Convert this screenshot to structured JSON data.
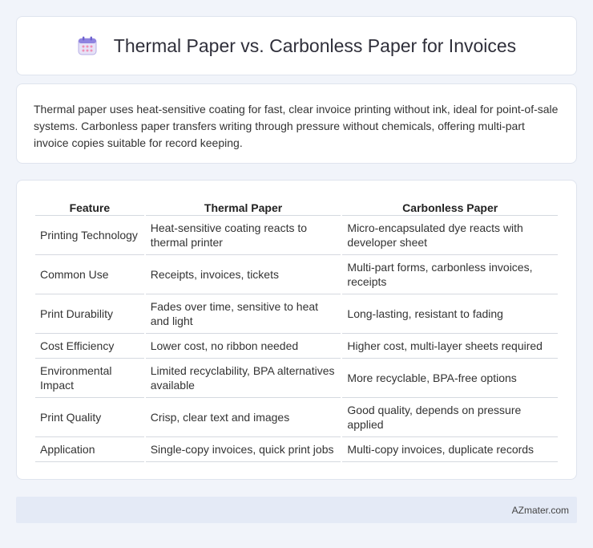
{
  "header": {
    "title": "Thermal Paper vs. Carbonless Paper for Invoices",
    "icon": "calendar-icon"
  },
  "intro": {
    "text": "Thermal paper uses heat-sensitive coating for fast, clear invoice printing without ink, ideal for point-of-sale systems. Carbonless paper transfers writing through pressure without chemicals, offering multi-part invoice copies suitable for record keeping."
  },
  "table": {
    "headers": [
      "Feature",
      "Thermal Paper",
      "Carbonless Paper"
    ],
    "rows": [
      [
        "Printing Technology",
        "Heat-sensitive coating reacts to thermal printer",
        "Micro-encapsulated dye reacts with developer sheet"
      ],
      [
        "Common Use",
        "Receipts, invoices, tickets",
        "Multi-part forms, carbonless invoices, receipts"
      ],
      [
        "Print Durability",
        "Fades over time, sensitive to heat and light",
        "Long-lasting, resistant to fading"
      ],
      [
        "Cost Efficiency",
        "Lower cost, no ribbon needed",
        "Higher cost, multi-layer sheets required"
      ],
      [
        "Environmental Impact",
        "Limited recyclability, BPA alternatives available",
        "More recyclable, BPA-free options"
      ],
      [
        "Print Quality",
        "Crisp, clear text and images",
        "Good quality, depends on pressure applied"
      ],
      [
        "Application",
        "Single-copy invoices, quick print jobs",
        "Multi-copy invoices, duplicate records"
      ]
    ]
  },
  "footer": {
    "brand": "AZmater.com"
  }
}
